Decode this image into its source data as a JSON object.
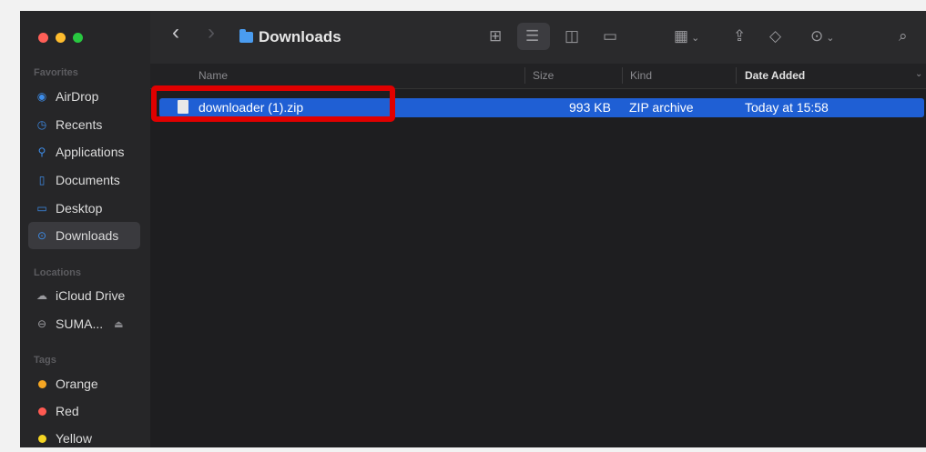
{
  "colors": {
    "accent": "#1f5fd4",
    "highlight": "#e00000"
  },
  "window": {
    "traffic": [
      "#ff5f57",
      "#febc2e",
      "#28c840"
    ]
  },
  "sidebar": {
    "favorites_title": "Favorites",
    "favorites": [
      {
        "label": "AirDrop",
        "icon": "airdrop-icon"
      },
      {
        "label": "Recents",
        "icon": "clock-icon"
      },
      {
        "label": "Applications",
        "icon": "applications-icon"
      },
      {
        "label": "Documents",
        "icon": "document-icon"
      },
      {
        "label": "Desktop",
        "icon": "desktop-icon"
      },
      {
        "label": "Downloads",
        "icon": "download-icon",
        "selected": true
      }
    ],
    "locations_title": "Locations",
    "locations": [
      {
        "label": "iCloud Drive",
        "icon": "cloud-icon"
      },
      {
        "label": "SUMA...",
        "icon": "drive-icon"
      }
    ],
    "tags_title": "Tags",
    "tags": [
      {
        "label": "Orange",
        "color": "#f5a623"
      },
      {
        "label": "Red",
        "color": "#ff5a52"
      },
      {
        "label": "Yellow",
        "color": "#f5d523"
      }
    ]
  },
  "toolbar": {
    "title": "Downloads",
    "back_glyph": "‹",
    "forward_glyph": "›"
  },
  "columns": {
    "name": "Name",
    "size": "Size",
    "kind": "Kind",
    "date": "Date Added"
  },
  "files": [
    {
      "name": "downloader (1).zip",
      "size": "993 KB",
      "kind": "ZIP archive",
      "date": "Today at 15:58",
      "selected": true
    }
  ]
}
